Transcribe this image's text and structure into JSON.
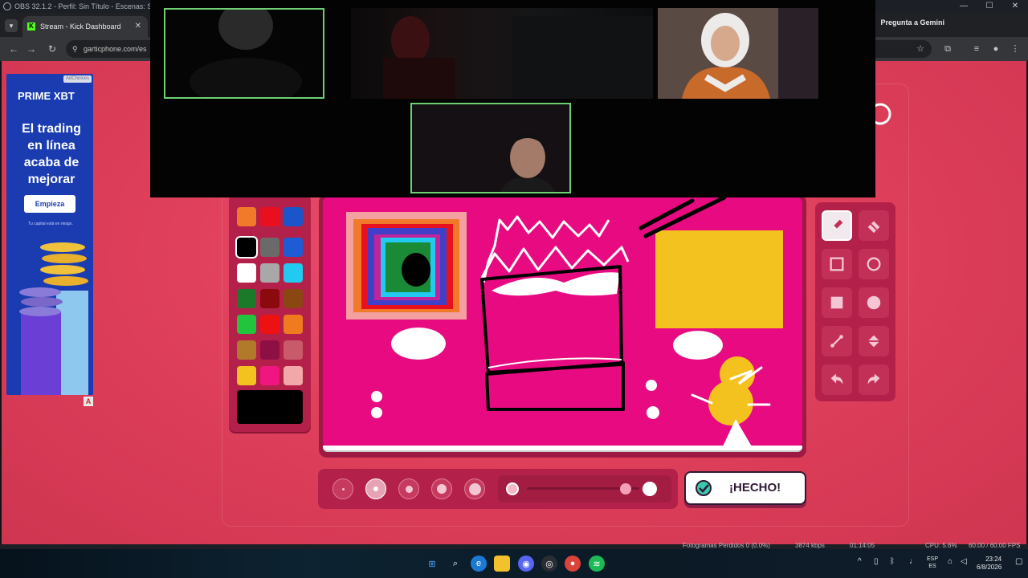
{
  "obs": {
    "title": "OBS 32.1.2 - Perfil: Sin Título - Escenas: Sin Título"
  },
  "window_controls": {
    "minimize": "—",
    "maximize": "☐",
    "close": "✕"
  },
  "browser": {
    "tab_title": "Stream - Kick Dashboard",
    "tab_icon_letter": "K",
    "url": "garticphone.com/es",
    "gemini_label": "Pregunta a Gemini"
  },
  "ad": {
    "badge": "AdChoices",
    "brand": "PRIME XBT",
    "headline": "El trading en línea acaba de mejorar",
    "cta": "Empieza",
    "disclaimer": "Tu capital está en riesgo.",
    "corner_label": "A"
  },
  "palette": {
    "colors": [
      [
        "#f07a2a",
        "#e8101e",
        "#1a55c9"
      ],
      [
        "#000000",
        "#6a6a6a",
        "#1e5cd6"
      ],
      [
        "#ffffff",
        "#a8a8a8",
        "#22c9f0"
      ],
      [
        "#1b7a2a",
        "#8a0a0e",
        "#8a4712"
      ],
      [
        "#22c43e",
        "#ee1111",
        "#f07a1e"
      ],
      [
        "#b07a2a",
        "#8e0f44",
        "#c95a6a"
      ],
      [
        "#f4c21e",
        "#f0157f",
        "#f2a8a8"
      ]
    ],
    "selected": "#000000",
    "current": "#000000"
  },
  "canvas": {
    "background": "#e70a80"
  },
  "tools": {
    "items": [
      "pencil",
      "eraser",
      "rectangle-outline",
      "circle-outline",
      "rectangle-fill",
      "circle-fill",
      "line",
      "fill-bucket",
      "undo",
      "redo"
    ],
    "active": "pencil"
  },
  "brush_sizes": {
    "count": 5,
    "selected_index": 1
  },
  "opacity": {
    "value": 0.88
  },
  "done_button": {
    "label": "¡HECHO!"
  },
  "obs_stats": {
    "dropped": "Fotogramas Perdidos 0 (0.0%)",
    "bitrate": "3874 kbps",
    "time": "01:14:05",
    "cpu": "CPU: 5.6%",
    "fps": "60.00 / 60.00 FPS"
  },
  "taskbar": {
    "lang_top": "ESP",
    "lang_bottom": "ES",
    "time": "23:24",
    "date": "6/8/2026"
  }
}
